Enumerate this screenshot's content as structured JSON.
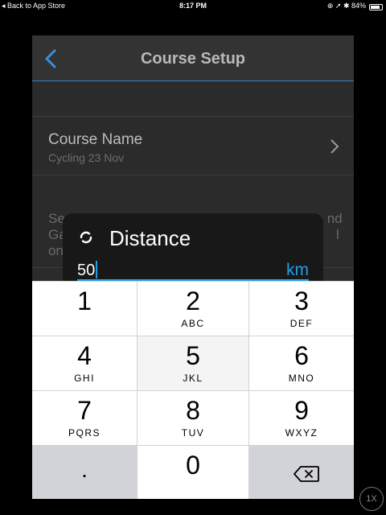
{
  "status_bar": {
    "back_label": "◂ Back to App Store",
    "time": "8:17 PM",
    "indicators": "⊕ ➚ ✱ 84%",
    "battery_percent": 84
  },
  "nav": {
    "title": "Course Setup",
    "back_icon": "chevron-left-icon"
  },
  "course_name": {
    "label": "Course Name",
    "value": "Cycling 23 Nov"
  },
  "description_visible": "Se                                                                     nd\nGa                                                                       l\non",
  "dialog": {
    "title": "Distance",
    "value": "50",
    "unit": "km"
  },
  "keypad": {
    "keys": [
      {
        "num": "1",
        "letters": ""
      },
      {
        "num": "2",
        "letters": "ABC"
      },
      {
        "num": "3",
        "letters": "DEF"
      },
      {
        "num": "4",
        "letters": "GHI"
      },
      {
        "num": "5",
        "letters": "JKL"
      },
      {
        "num": "6",
        "letters": "MNO"
      },
      {
        "num": "7",
        "letters": "PQRS"
      },
      {
        "num": "8",
        "letters": "TUV"
      },
      {
        "num": "9",
        "letters": "WXYZ"
      },
      {
        "num": ".",
        "letters": ""
      },
      {
        "num": "0",
        "letters": ""
      },
      {
        "num": "",
        "letters": ""
      }
    ]
  },
  "zoom_label": "1X",
  "colors": {
    "accent": "#1da1e6",
    "nav_chevron": "#3a8ed6",
    "app_bg": "#2b2b2b",
    "dialog_bg": "#181818",
    "keypad_bg": "#d1d3d8"
  }
}
